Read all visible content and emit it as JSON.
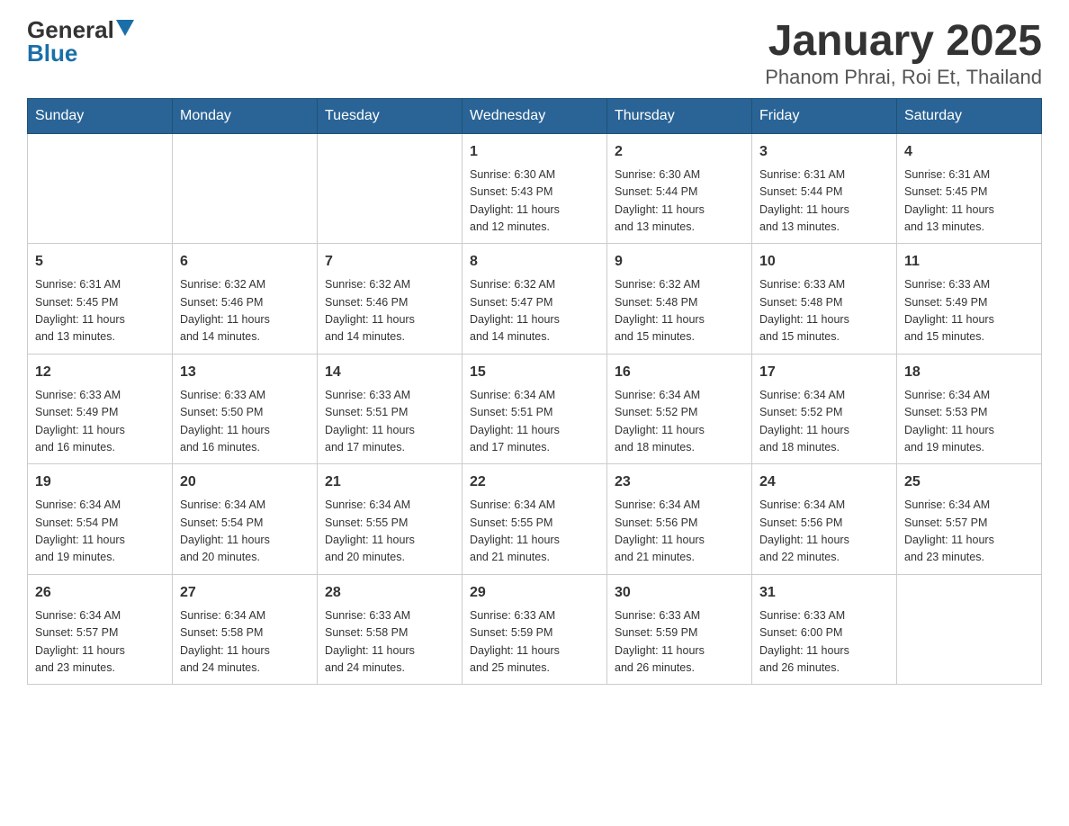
{
  "logo": {
    "text_general": "General",
    "text_blue": "Blue"
  },
  "title": "January 2025",
  "subtitle": "Phanom Phrai, Roi Et, Thailand",
  "days_of_week": [
    "Sunday",
    "Monday",
    "Tuesday",
    "Wednesday",
    "Thursday",
    "Friday",
    "Saturday"
  ],
  "weeks": [
    [
      {
        "day": "",
        "info": ""
      },
      {
        "day": "",
        "info": ""
      },
      {
        "day": "",
        "info": ""
      },
      {
        "day": "1",
        "info": "Sunrise: 6:30 AM\nSunset: 5:43 PM\nDaylight: 11 hours\nand 12 minutes."
      },
      {
        "day": "2",
        "info": "Sunrise: 6:30 AM\nSunset: 5:44 PM\nDaylight: 11 hours\nand 13 minutes."
      },
      {
        "day": "3",
        "info": "Sunrise: 6:31 AM\nSunset: 5:44 PM\nDaylight: 11 hours\nand 13 minutes."
      },
      {
        "day": "4",
        "info": "Sunrise: 6:31 AM\nSunset: 5:45 PM\nDaylight: 11 hours\nand 13 minutes."
      }
    ],
    [
      {
        "day": "5",
        "info": "Sunrise: 6:31 AM\nSunset: 5:45 PM\nDaylight: 11 hours\nand 13 minutes."
      },
      {
        "day": "6",
        "info": "Sunrise: 6:32 AM\nSunset: 5:46 PM\nDaylight: 11 hours\nand 14 minutes."
      },
      {
        "day": "7",
        "info": "Sunrise: 6:32 AM\nSunset: 5:46 PM\nDaylight: 11 hours\nand 14 minutes."
      },
      {
        "day": "8",
        "info": "Sunrise: 6:32 AM\nSunset: 5:47 PM\nDaylight: 11 hours\nand 14 minutes."
      },
      {
        "day": "9",
        "info": "Sunrise: 6:32 AM\nSunset: 5:48 PM\nDaylight: 11 hours\nand 15 minutes."
      },
      {
        "day": "10",
        "info": "Sunrise: 6:33 AM\nSunset: 5:48 PM\nDaylight: 11 hours\nand 15 minutes."
      },
      {
        "day": "11",
        "info": "Sunrise: 6:33 AM\nSunset: 5:49 PM\nDaylight: 11 hours\nand 15 minutes."
      }
    ],
    [
      {
        "day": "12",
        "info": "Sunrise: 6:33 AM\nSunset: 5:49 PM\nDaylight: 11 hours\nand 16 minutes."
      },
      {
        "day": "13",
        "info": "Sunrise: 6:33 AM\nSunset: 5:50 PM\nDaylight: 11 hours\nand 16 minutes."
      },
      {
        "day": "14",
        "info": "Sunrise: 6:33 AM\nSunset: 5:51 PM\nDaylight: 11 hours\nand 17 minutes."
      },
      {
        "day": "15",
        "info": "Sunrise: 6:34 AM\nSunset: 5:51 PM\nDaylight: 11 hours\nand 17 minutes."
      },
      {
        "day": "16",
        "info": "Sunrise: 6:34 AM\nSunset: 5:52 PM\nDaylight: 11 hours\nand 18 minutes."
      },
      {
        "day": "17",
        "info": "Sunrise: 6:34 AM\nSunset: 5:52 PM\nDaylight: 11 hours\nand 18 minutes."
      },
      {
        "day": "18",
        "info": "Sunrise: 6:34 AM\nSunset: 5:53 PM\nDaylight: 11 hours\nand 19 minutes."
      }
    ],
    [
      {
        "day": "19",
        "info": "Sunrise: 6:34 AM\nSunset: 5:54 PM\nDaylight: 11 hours\nand 19 minutes."
      },
      {
        "day": "20",
        "info": "Sunrise: 6:34 AM\nSunset: 5:54 PM\nDaylight: 11 hours\nand 20 minutes."
      },
      {
        "day": "21",
        "info": "Sunrise: 6:34 AM\nSunset: 5:55 PM\nDaylight: 11 hours\nand 20 minutes."
      },
      {
        "day": "22",
        "info": "Sunrise: 6:34 AM\nSunset: 5:55 PM\nDaylight: 11 hours\nand 21 minutes."
      },
      {
        "day": "23",
        "info": "Sunrise: 6:34 AM\nSunset: 5:56 PM\nDaylight: 11 hours\nand 21 minutes."
      },
      {
        "day": "24",
        "info": "Sunrise: 6:34 AM\nSunset: 5:56 PM\nDaylight: 11 hours\nand 22 minutes."
      },
      {
        "day": "25",
        "info": "Sunrise: 6:34 AM\nSunset: 5:57 PM\nDaylight: 11 hours\nand 23 minutes."
      }
    ],
    [
      {
        "day": "26",
        "info": "Sunrise: 6:34 AM\nSunset: 5:57 PM\nDaylight: 11 hours\nand 23 minutes."
      },
      {
        "day": "27",
        "info": "Sunrise: 6:34 AM\nSunset: 5:58 PM\nDaylight: 11 hours\nand 24 minutes."
      },
      {
        "day": "28",
        "info": "Sunrise: 6:33 AM\nSunset: 5:58 PM\nDaylight: 11 hours\nand 24 minutes."
      },
      {
        "day": "29",
        "info": "Sunrise: 6:33 AM\nSunset: 5:59 PM\nDaylight: 11 hours\nand 25 minutes."
      },
      {
        "day": "30",
        "info": "Sunrise: 6:33 AM\nSunset: 5:59 PM\nDaylight: 11 hours\nand 26 minutes."
      },
      {
        "day": "31",
        "info": "Sunrise: 6:33 AM\nSunset: 6:00 PM\nDaylight: 11 hours\nand 26 minutes."
      },
      {
        "day": "",
        "info": ""
      }
    ]
  ]
}
